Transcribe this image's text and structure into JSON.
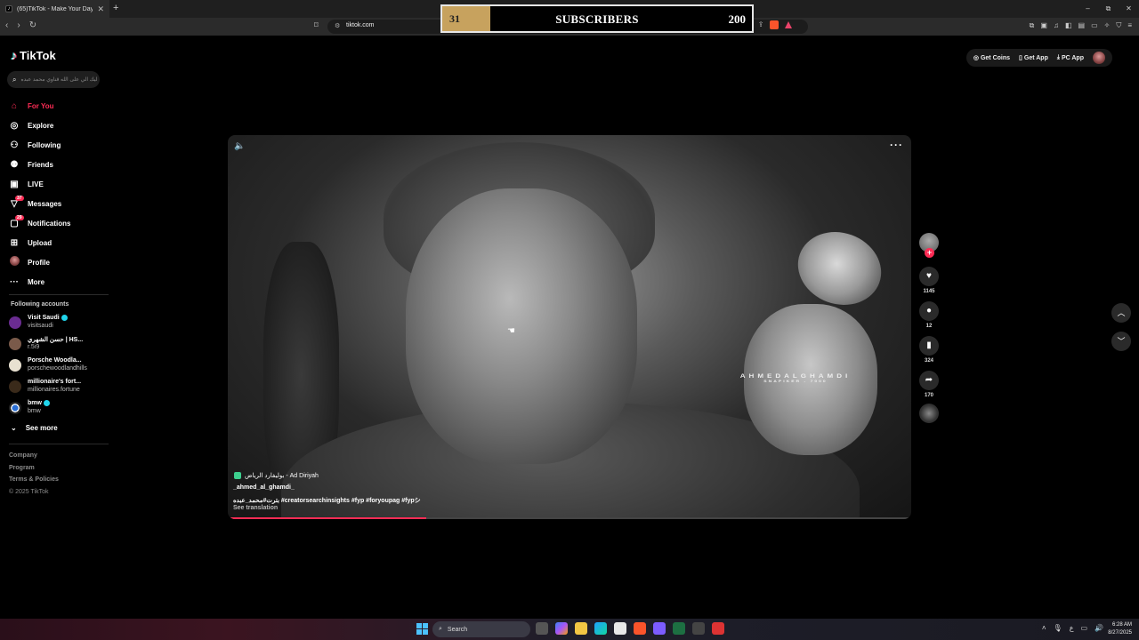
{
  "browser": {
    "tab_title": "(65)TikTok - Make Your Day",
    "tab_close": "✕",
    "new_tab": "+",
    "url": "tiktok.com",
    "window_controls": [
      "–",
      "⧉",
      "✕"
    ]
  },
  "overlay": {
    "count": "31",
    "label": "SUBSCRIBERS",
    "goal": "200",
    "progress_fraction": 0.155
  },
  "tiktok": {
    "logo_text": "TikTok",
    "search_placeholder": "ليك الي على الله قناوي محمد عبده",
    "header_actions": {
      "get_coins": "Get Coins",
      "get_app": "Get App",
      "pc_app": "PC App"
    },
    "menu": [
      {
        "label": "For You",
        "icon": "home-icon"
      },
      {
        "label": "Explore",
        "icon": "compass-icon"
      },
      {
        "label": "Following",
        "icon": "user-icon"
      },
      {
        "label": "Friends",
        "icon": "friends-icon"
      },
      {
        "label": "LIVE",
        "icon": "live-icon"
      },
      {
        "label": "Messages",
        "icon": "message-icon",
        "badge": "37"
      },
      {
        "label": "Notifications",
        "icon": "bell-icon",
        "badge": "29"
      },
      {
        "label": "Upload",
        "icon": "upload-icon"
      },
      {
        "label": "Profile",
        "icon": "avatar-icon"
      },
      {
        "label": "More",
        "icon": "more-icon"
      }
    ],
    "following_title": "Following accounts",
    "following_accounts": [
      {
        "name": "Visit Saudi",
        "handle": "visitsaudi",
        "verified": true
      },
      {
        "name": "حسن الشهري | HS...",
        "handle": "r.5i9",
        "verified": false
      },
      {
        "name": "Porsche Woodla...",
        "handle": "porschewoodlandhills",
        "verified": false
      },
      {
        "name": "millionaire's fort...",
        "handle": "millionaires.fortune",
        "verified": false
      },
      {
        "name": "bmw",
        "handle": "bmw",
        "verified": true
      }
    ],
    "see_more": "See more",
    "footer": [
      "Company",
      "Program",
      "Terms & Policies",
      "© 2025 TikTok"
    ],
    "video": {
      "location": "بوليفارد الرياض - Ad Diriyah",
      "username": "_ahmed_al_ghamdi_",
      "caption": "بترت#محمد_عبده #creatorsearchinsights #fyp #foryoupag #fypシ",
      "see_translation": "See translation",
      "watermark": "AHMEDALGHAMDI",
      "watermark_sub": "SNAPIKER - 7000",
      "progress_fraction": 0.29
    },
    "rail": {
      "likes": "1145",
      "comments": "12",
      "saves": "324",
      "shares": "170"
    }
  },
  "taskbar": {
    "search_label": "Search",
    "time": "6:28 AM",
    "date": "8/27/2025",
    "lang": "ع"
  }
}
